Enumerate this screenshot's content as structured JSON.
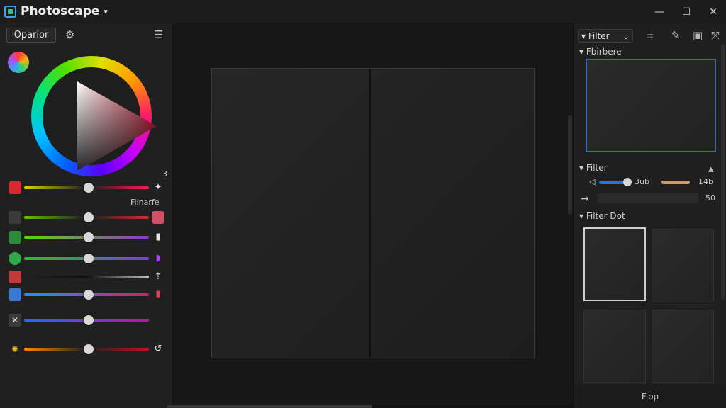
{
  "app": {
    "title": "Photoscape"
  },
  "window": {
    "minimize": "—",
    "maximize": "☐",
    "close": "✕"
  },
  "left": {
    "tab_label": "Oparior",
    "value_top": "3",
    "label_mid": "Fiinarfe"
  },
  "right": {
    "filter_dropdown": "Filter",
    "section_preview": "Fbirbere",
    "section_filter": "Filter",
    "filter_value_a": "3ub",
    "filter_value_b": "14b",
    "filter_value_c": "50",
    "section_filter_dot": "Filter Dot",
    "bottom_label": "Fiop"
  },
  "colors": {
    "accent": "#3a6ea8",
    "brand": "#3aa0ff"
  }
}
